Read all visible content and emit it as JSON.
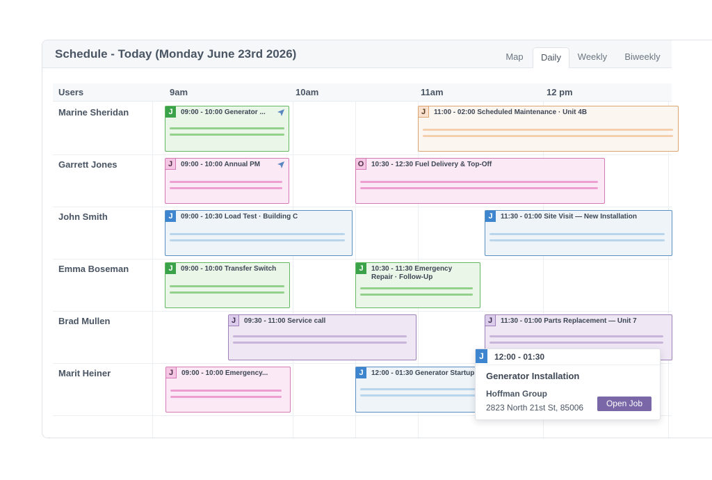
{
  "header": {
    "title": "Schedule - Today (Monday June 23rd 2026)"
  },
  "view_tabs": [
    {
      "label": "Map",
      "active": false
    },
    {
      "label": "Daily",
      "active": true
    },
    {
      "label": "Weekly",
      "active": false
    },
    {
      "label": "Biweekly",
      "active": false
    }
  ],
  "grid": {
    "users_header": "Users",
    "time_columns": [
      "9am",
      "10am",
      "11am",
      "12 pm"
    ]
  },
  "users": [
    "Marine Sheridan",
    "Garrett Jones",
    "John Smith",
    "Emma Boseman",
    "Brad Mullen",
    "Marit Heiner"
  ],
  "events": [
    {
      "user": "Marine Sheridan",
      "badge": "J",
      "text": "09:00 - 10:00 Generator ...",
      "color": "green",
      "navigation_icon": true
    },
    {
      "user": "Marine Sheridan",
      "badge": "J",
      "text": "11:00 - 02:00 Scheduled Maintenance · Unit 4B",
      "color": "orange"
    },
    {
      "user": "Garrett Jones",
      "badge": "J",
      "text": "09:00 - 10:00 Annual PM",
      "color": "pink",
      "navigation_icon": true
    },
    {
      "user": "Garrett Jones",
      "badge": "O",
      "text": "10:30 - 12:30 Fuel Delivery & Top-Off",
      "color": "pink"
    },
    {
      "user": "John Smith",
      "badge": "J",
      "text": "09:00 - 10:30 Load Test · Building C",
      "color": "blue"
    },
    {
      "user": "John Smith",
      "badge": "J",
      "text": "11:30 - 01:00 Site Visit — New Installation",
      "color": "blue"
    },
    {
      "user": "Emma Boseman",
      "badge": "J",
      "text": "09:00 - 10:00 Transfer Switch",
      "color": "green"
    },
    {
      "user": "Emma Boseman",
      "badge": "J",
      "text": "10:30 - 11:30 Emergency Repair · Follow-Up",
      "color": "green"
    },
    {
      "user": "Brad Mullen",
      "badge": "J",
      "text": "09:30 - 11:00 Service call",
      "color": "purple"
    },
    {
      "user": "Brad Mullen",
      "badge": "J",
      "text": "11:30 - 01:00 Parts Replacement — Unit 7",
      "color": "purple"
    },
    {
      "user": "Marit Heiner",
      "badge": "J",
      "text": "09:00 - 10:00 Emergency...",
      "color": "pink"
    },
    {
      "user": "Marit Heiner",
      "badge": "J",
      "text": "12:00 - 01:30 Generator Startup",
      "color": "blue"
    }
  ],
  "popup": {
    "badge": "J",
    "time": "12:00 - 01:30",
    "title": "Generator Installation",
    "company": "Hoffman Group",
    "address": "2823 North 21st St, 85006",
    "button_label": "Open Job"
  },
  "colors": {
    "green": "#62b760",
    "pink": "#d479b6",
    "orange": "#dba36f",
    "blue": "#5a8fc1",
    "purple": "#9b7fb6",
    "button": "#7a67a8"
  }
}
